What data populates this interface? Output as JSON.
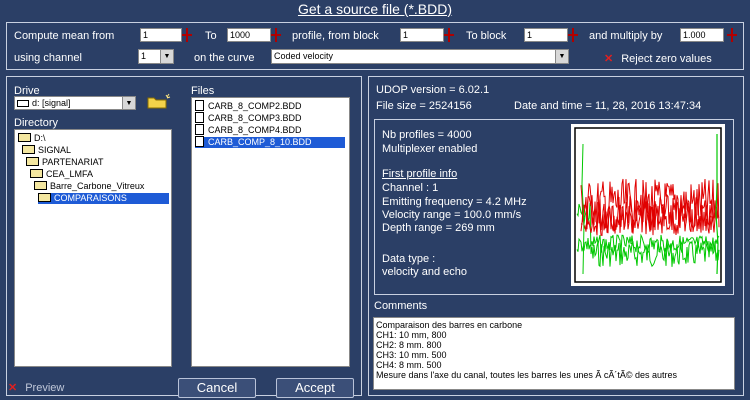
{
  "title": "Get a source file (*.BDD)",
  "compute": {
    "compute_mean_label": "Compute mean from",
    "from_value": "1",
    "to_label": "To",
    "to_value": "1000",
    "profile_from_block_label": "profile, from block",
    "from_block_value": "1",
    "to_block_label": "To block",
    "to_block_value": "1",
    "multiply_label": "and multiply by",
    "multiply_value": "1.000",
    "using_channel_label": "using channel",
    "channel_value": "1",
    "on_curve_label": "on the curve",
    "curve_value": "Coded velocity",
    "reject_zero_label": "Reject zero values"
  },
  "drive": {
    "label": "Drive",
    "value": "d: [signal]"
  },
  "directory": {
    "label": "Directory",
    "items": [
      "D:\\",
      "SIGNAL",
      "PARTENARIAT",
      "CEA_LMFA",
      "Barre_Carbone_Vitreux",
      "COMPARAISONS"
    ],
    "selected_index": 5
  },
  "files": {
    "label": "Files",
    "items": [
      "CARB_8_COMP2.BDD",
      "CARB_8_COMP3.BDD",
      "CARB_8_COMP4.BDD",
      "CARB_COMP_8_10.BDD"
    ],
    "selected_index": 3
  },
  "info": {
    "udop_version": "UDOP version = 6.02.1",
    "file_size": "File size = 2524156",
    "date_time": "Date and time = 11, 28, 2016   13:47:34",
    "nb_profiles": "Nb profiles = 4000",
    "multiplexer": "Multiplexer enabled",
    "first_profile_heading": "First profile info",
    "channel": "Channel : 1",
    "emitting_frequency": "Emitting frequency = 4.2 MHz",
    "velocity_range": "Velocity range = 100.0 mm/s",
    "depth_range": "Depth range = 269 mm",
    "data_type_label": "Data type  :",
    "data_type_value": "velocity and echo"
  },
  "comments": {
    "label": "Comments",
    "lines": [
      "Comparaison des barres en carbone",
      "CH1: 10 mm, 800",
      "CH2: 8 mm. 800",
      "CH3: 10 mm. 500",
      "CH4: 8 mm. 500",
      "Mesure dans l'axe du canal, toutes les barres les unes Ã  cÃ´tÃ© des autres"
    ]
  },
  "buttons": {
    "preview": "Preview",
    "cancel": "Cancel",
    "accept": "Accept"
  },
  "colors": {
    "background": "#2b3f66",
    "selection": "#1e5bd6",
    "accent_red": "#e02020",
    "plot_red": "#e00000",
    "plot_green": "#00c800"
  }
}
